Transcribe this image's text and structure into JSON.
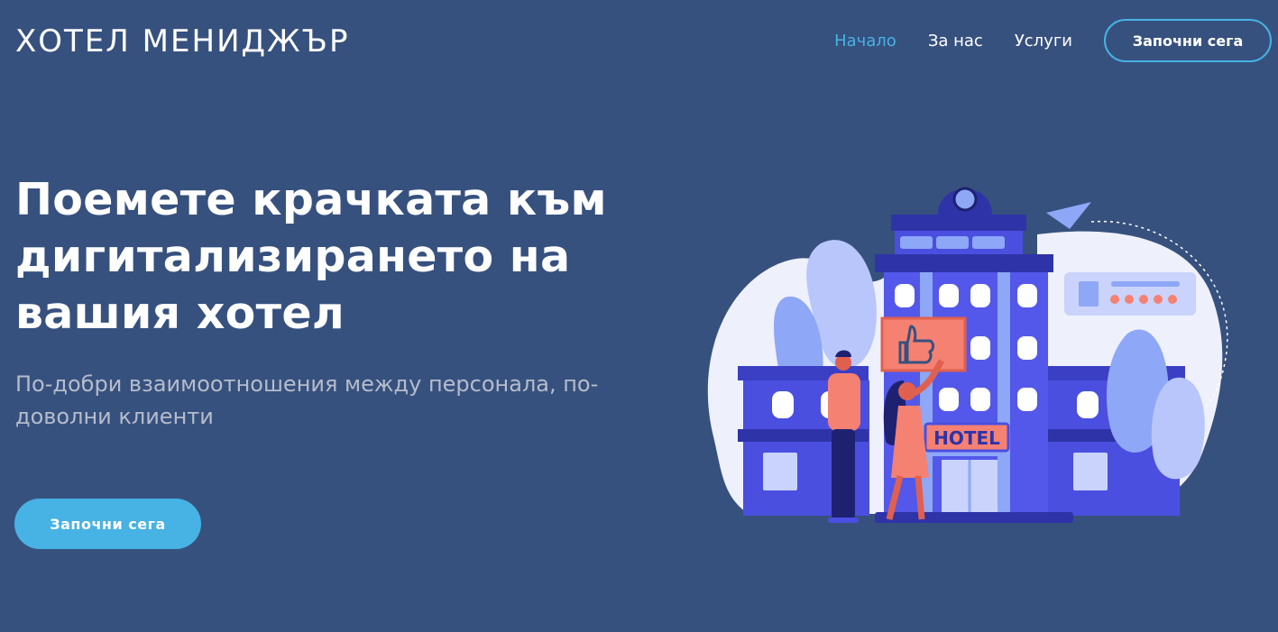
{
  "header": {
    "logo": "ХОТЕЛ МЕНИДЖЪР",
    "nav": {
      "home": "Начало",
      "about": "За нас",
      "services": "Услуги",
      "cta": "Започни сега"
    }
  },
  "hero": {
    "title": "Поемете крачката към дигитализирането на вашия хотел",
    "subtitle": "По-добри взаимоотношения между персонала, по-доволни клиенти",
    "cta": "Започни сега"
  },
  "illustration": {
    "sign_text": "HOTEL",
    "icons": [
      "thumbs-up-icon",
      "paper-plane-icon",
      "hotel-building-icon",
      "star-icon"
    ]
  },
  "colors": {
    "background": "#37517e",
    "accent": "#47b2e4",
    "subtitle": "#b5bccc",
    "building": "#4a4fdf",
    "coral": "#f58172"
  }
}
